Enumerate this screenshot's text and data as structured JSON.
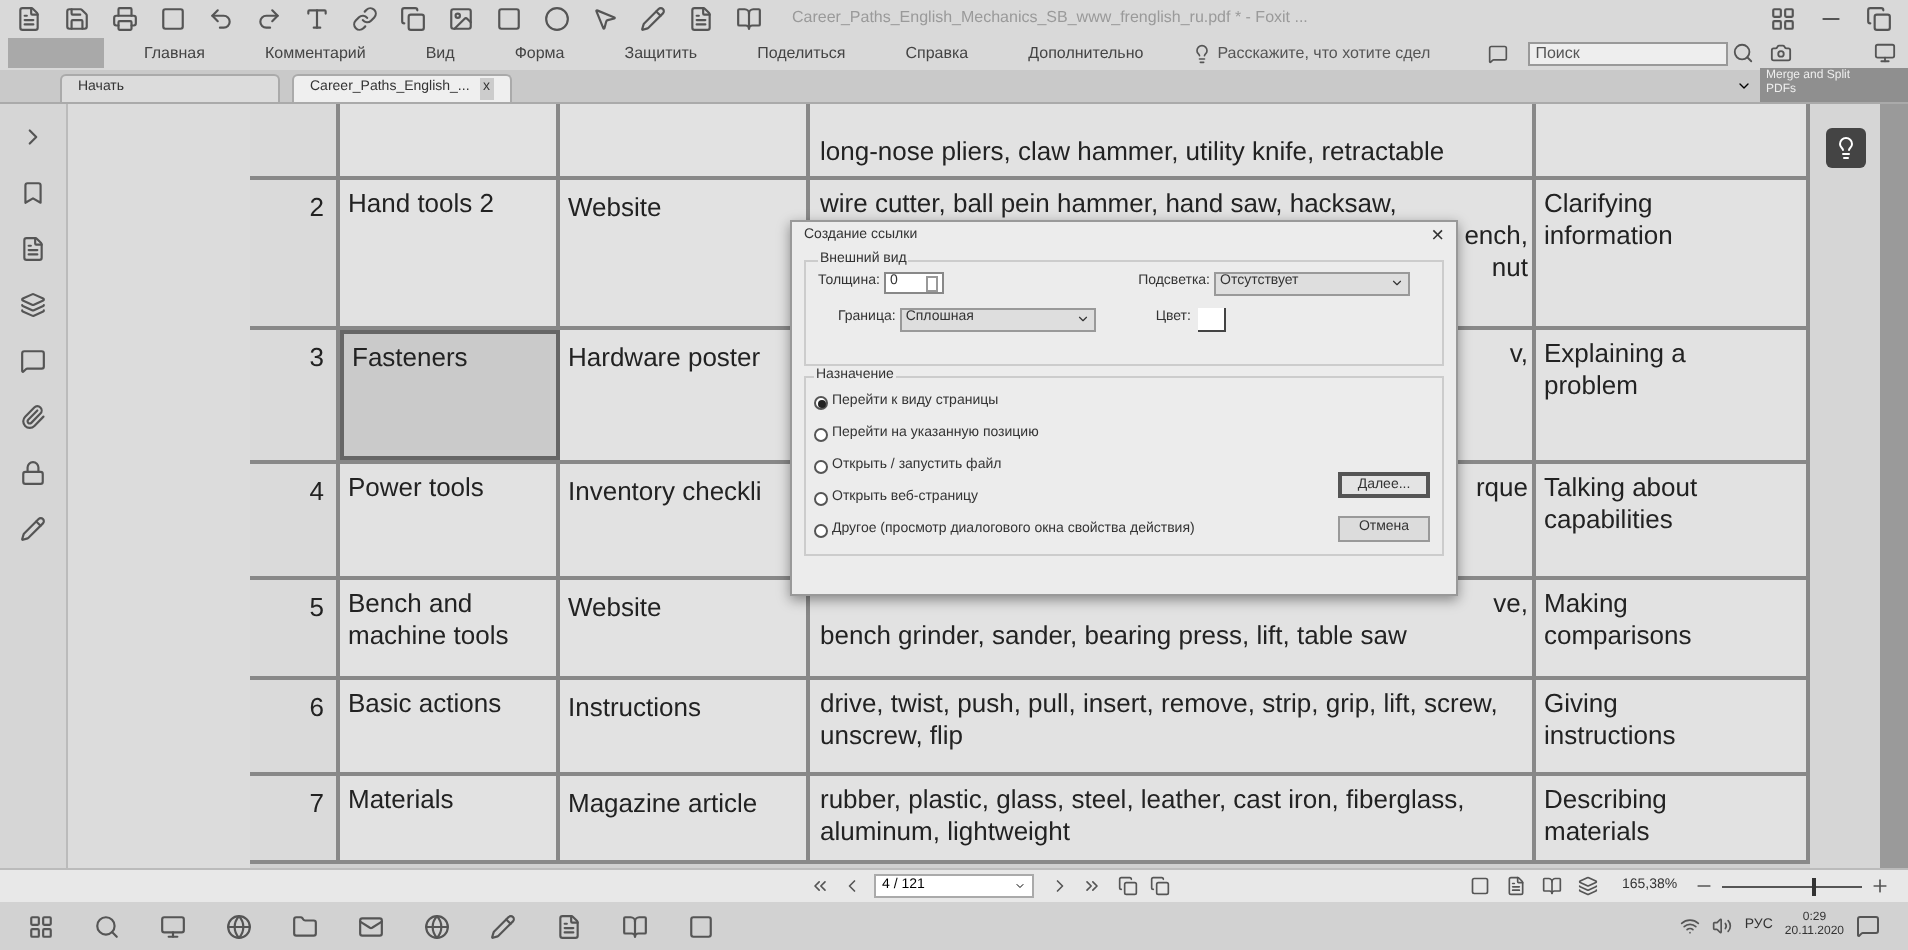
{
  "window": {
    "title": "Career_Paths_English_Mechanics_SB_www_frenglish_ru.pdf * - Foxit ..."
  },
  "menu": [
    {
      "label": "Главная"
    },
    {
      "label": "Комментарий"
    },
    {
      "label": "Вид"
    },
    {
      "label": "Форма"
    },
    {
      "label": "Защитить"
    },
    {
      "label": "Поделиться"
    },
    {
      "label": "Справка"
    },
    {
      "label": "Дополнительно"
    }
  ],
  "tell_me": {
    "placeholder": "Расскажите, что хотите сдел"
  },
  "search": {
    "placeholder": "Поиск"
  },
  "merge_button": "Merge and Split PDFs",
  "tabs": [
    {
      "label": "Начать",
      "selected": false
    },
    {
      "label": "Career_Paths_English_...",
      "selected": true,
      "close": "x"
    }
  ],
  "table": {
    "rows": [
      {
        "lines": [
          {
            "text": "long-nose pliers, claw hammer, utility knife, retractable",
            "clipped": false
          }
        ],
        "selected": false
      },
      {
        "num": "2",
        "topic": "Hand tools 2",
        "source": "Website",
        "lines": [
          {
            "text": "wire cutter, ball pein hammer, hand saw, hacksaw,",
            "clipped": false
          },
          {
            "text": "ench,",
            "clipped": true
          },
          {
            "text": "nut",
            "clipped": true
          }
        ],
        "function": "Clarifying information",
        "selected": false
      },
      {
        "num": "3",
        "topic": "Fasteners",
        "source": "Hardware poster",
        "lines": [
          {
            "text": "v,",
            "clipped": true
          }
        ],
        "function": "Explaining a problem",
        "selected": true
      },
      {
        "num": "4",
        "topic": "Power tools",
        "source": "Inventory checkli",
        "lines": [
          {
            "text": "rque",
            "clipped": true
          }
        ],
        "function": "Talking about capabilities",
        "selected": false
      },
      {
        "num": "5",
        "topic": "Bench and machine tools",
        "source": "Website",
        "lines": [
          {
            "text": "ve,",
            "clipped": true
          },
          {
            "text": "bench grinder, sander, bearing press, lift, table saw",
            "clipped": false
          }
        ],
        "function": "Making comparisons",
        "selected": false
      },
      {
        "num": "6",
        "topic": "Basic actions",
        "source": "Instructions",
        "lines": [
          {
            "text": "drive, twist, push, pull, insert, remove, strip, grip, lift, screw, unscrew, flip",
            "clipped": false
          }
        ],
        "function": "Giving instructions",
        "selected": false
      },
      {
        "num": "7",
        "topic": "Materials",
        "source": "Magazine article",
        "lines": [
          {
            "text": "rubber, plastic, glass, steel, leather, cast iron, fiberglass, aluminum, lightweight",
            "clipped": false
          }
        ],
        "function": "Describing materials",
        "selected": false
      }
    ]
  },
  "dialog": {
    "title": "Создание ссылки",
    "close": "×",
    "appearance": {
      "legend": "Внешний вид",
      "thickness_label": "Толщина:",
      "thickness": "0",
      "highlight_label": "Подсветка:",
      "highlight": "Отсутствует",
      "border_label": "Граница:",
      "border": "Сплошная",
      "color_label": "Цвет:"
    },
    "action": {
      "legend": "Назначение",
      "options": [
        {
          "label": "Перейти к виду страницы",
          "selected": true
        },
        {
          "label": "Перейти на указанную позицию",
          "selected": false
        },
        {
          "label": "Открыть / запустить файл",
          "selected": false
        },
        {
          "label": "Открыть веб-страницу",
          "selected": false
        },
        {
          "label": "Другое (просмотр диалогового окна свойства действия)",
          "selected": false
        }
      ]
    },
    "buttons": [
      "Далее...",
      "Отмена"
    ]
  },
  "page_nav": {
    "page": "4 / 121",
    "zoom": "165,38%",
    "zoom_slider": {
      "level": 0.65
    }
  },
  "taskbar": {
    "language": "РУС",
    "time": "0:29",
    "date": "20.11.2020"
  }
}
